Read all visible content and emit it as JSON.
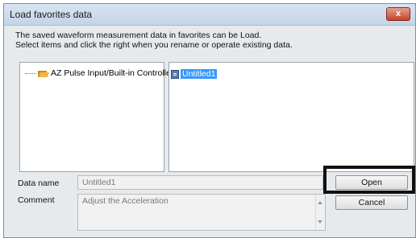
{
  "window": {
    "title": "Load favorites data",
    "close_glyph": "x"
  },
  "description": {
    "line1": "The saved waveform measurement data in favorites can be Load.",
    "line2": "Select items and click the right when you rename or operate existing data."
  },
  "tree": {
    "item_label": "AZ Pulse Input/Built-in Controller",
    "icon": "folder-icon"
  },
  "files": {
    "items": [
      {
        "label": "Untitled1",
        "icon": "file-icon",
        "selected": true
      }
    ]
  },
  "form": {
    "data_name_label": "Data name",
    "data_name_value": "Untitled1",
    "comment_label": "Comment",
    "comment_value": "Adjust the Acceleration"
  },
  "buttons": {
    "open": "Open",
    "cancel": "Cancel"
  }
}
